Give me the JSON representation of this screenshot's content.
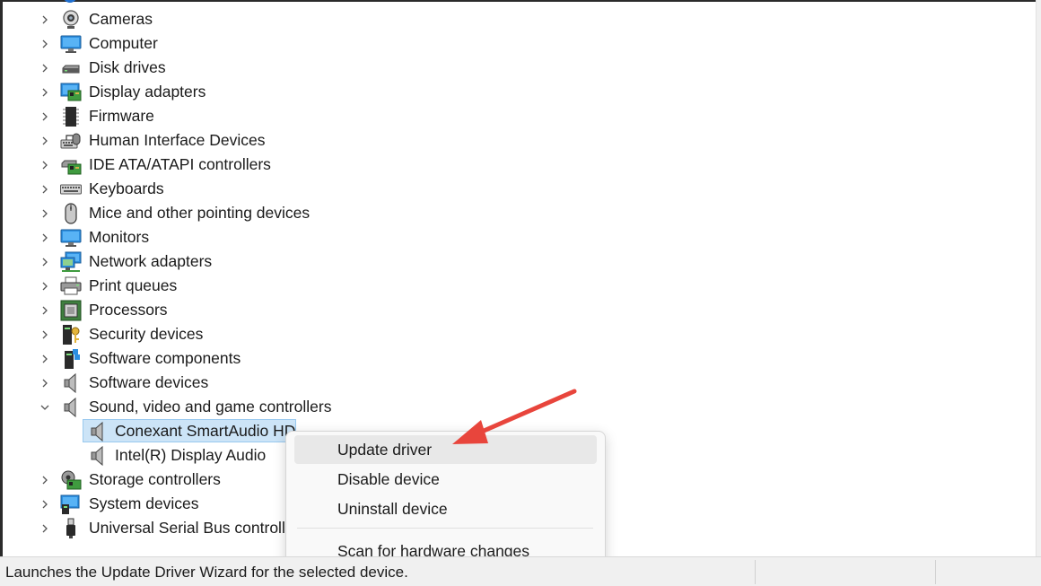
{
  "tree": {
    "items": [
      {
        "label": "Cameras",
        "icon": "camera-icon"
      },
      {
        "label": "Computer",
        "icon": "computer-icon"
      },
      {
        "label": "Disk drives",
        "icon": "disk-drive-icon"
      },
      {
        "label": "Display adapters",
        "icon": "display-adapter-icon"
      },
      {
        "label": "Firmware",
        "icon": "firmware-chip-icon"
      },
      {
        "label": "Human Interface Devices",
        "icon": "hid-icon"
      },
      {
        "label": "IDE ATA/ATAPI controllers",
        "icon": "ide-controller-icon"
      },
      {
        "label": "Keyboards",
        "icon": "keyboard-icon"
      },
      {
        "label": "Mice and other pointing devices",
        "icon": "mouse-icon"
      },
      {
        "label": "Monitors",
        "icon": "monitor-icon"
      },
      {
        "label": "Network adapters",
        "icon": "network-adapter-icon"
      },
      {
        "label": "Print queues",
        "icon": "printer-icon"
      },
      {
        "label": "Processors",
        "icon": "processor-icon"
      },
      {
        "label": "Security devices",
        "icon": "security-key-icon"
      },
      {
        "label": "Software components",
        "icon": "software-component-icon"
      },
      {
        "label": "Software devices",
        "icon": "speaker-icon"
      },
      {
        "label": "Sound, video and game controllers",
        "icon": "speaker-icon",
        "expanded": true
      },
      {
        "label": "Storage controllers",
        "icon": "storage-controller-icon"
      },
      {
        "label": "System devices",
        "icon": "system-devices-icon"
      },
      {
        "label": "Universal Serial Bus controllers",
        "icon": "usb-icon"
      }
    ],
    "sound_children": [
      {
        "label": "Conexant SmartAudio HD",
        "icon": "speaker-icon",
        "selected": true
      },
      {
        "label": "Intel(R) Display Audio",
        "icon": "speaker-icon"
      }
    ]
  },
  "context_menu": {
    "items": [
      {
        "label": "Update driver"
      },
      {
        "label": "Disable device"
      },
      {
        "label": "Uninstall device"
      },
      {
        "label": "Scan for hardware changes"
      }
    ]
  },
  "status_bar": {
    "text": "Launches the Update Driver Wizard for the selected device."
  },
  "colors": {
    "selection": "#cce4f7",
    "menu_hover": "#e8e8e8",
    "annotation_arrow": "#e8453c"
  }
}
